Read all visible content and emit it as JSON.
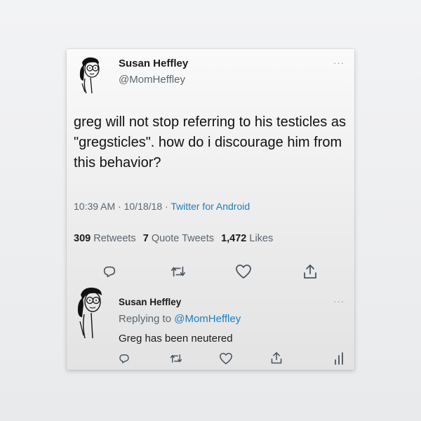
{
  "tweet": {
    "author_name": "Susan Heffley",
    "author_handle": "@MomHeffley",
    "more": "···",
    "text": "greg will not stop referring to his testicles as \"gregsticles\". how do i discourage him from this behavior?",
    "time": "10:39 AM",
    "date": "10/18/18",
    "separator": "·",
    "source": "Twitter for Android",
    "retweets_count": "309",
    "retweets_label": "Retweets",
    "quotes_count": "7",
    "quotes_label": "Quote Tweets",
    "likes_count": "1,472",
    "likes_label": "Likes",
    "actions": [
      "reply-icon",
      "retweet-icon",
      "like-icon",
      "share-icon"
    ]
  },
  "reply": {
    "author_name": "Susan Heffley",
    "more": "···",
    "replying_prefix": "Replying to",
    "replying_handle": "@MomHeffley",
    "text": "Greg has been neutered",
    "actions": [
      "reply-icon",
      "retweet-icon",
      "like-icon",
      "share-icon",
      "analytics-icon"
    ]
  },
  "colors": {
    "link": "#1b7ec2",
    "secondary_text": "#5b6670",
    "primary_text": "#1a1a1a"
  }
}
